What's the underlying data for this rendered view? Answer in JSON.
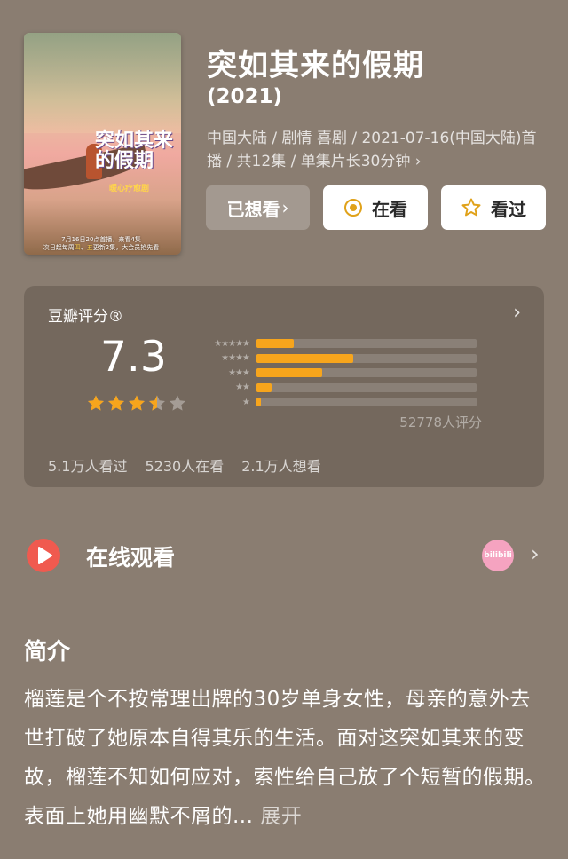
{
  "poster": {
    "title_art": "突如其来的假期",
    "subtitle_art": "暖心疗愈剧",
    "air_info_line1": "7月16日20点首播，来看4集",
    "air_info_line2_pre": "次日起每周",
    "air_info_highlight1": "四",
    "air_info_mid": "、",
    "air_info_highlight2": "五",
    "air_info_line2_post": "更新2集，大会员抢先看"
  },
  "header": {
    "title": "突如其来的假期",
    "year": "(2021)",
    "meta": "中国大陆 / 剧情 喜剧 / 2021-07-16(中国大陆)首播 / 共12集 / 单集片长30分钟 ›"
  },
  "actions": {
    "wishlist_label": "已想看",
    "wishlist_chevron": "›",
    "watching_label": "在看",
    "watched_label": "看过"
  },
  "rating": {
    "label": "豆瓣评分®",
    "score": "7.3",
    "star_value": 3.5,
    "star_max": 5,
    "rating_count": "52778人评分",
    "distribution": [
      {
        "stars": "★★★★★",
        "fraction": 0.17
      },
      {
        "stars": "★★★★",
        "fraction": 0.44
      },
      {
        "stars": "★★★",
        "fraction": 0.3
      },
      {
        "stars": "★★",
        "fraction": 0.07
      },
      {
        "stars": "★",
        "fraction": 0.02
      }
    ],
    "stats": {
      "watched": "5.1万人看过",
      "watching": "5230人在看",
      "wishlist": "2.1万人想看"
    }
  },
  "watch_online": {
    "label": "在线观看",
    "platform_logo": "bilibili",
    "chevron": "›"
  },
  "intro": {
    "heading": "简介",
    "text": "榴莲是个不按常理出牌的30岁单身女性，母亲的意外去世打破了她原本自得其乐的生活。面对这突如其来的变故，榴莲不知如何应对，索性给自己放了个短暂的假期。表面上她用幽默不屑的...",
    "expand_label": " 展开"
  },
  "colors": {
    "background": "#8a7d71",
    "accent_star": "#f7a51c",
    "play_red": "#f05a4f",
    "watching_icon": "#e0a21a"
  },
  "icons": {
    "watching": "target-circle-icon",
    "watched": "star-outline-icon",
    "play": "play-circle-icon"
  }
}
